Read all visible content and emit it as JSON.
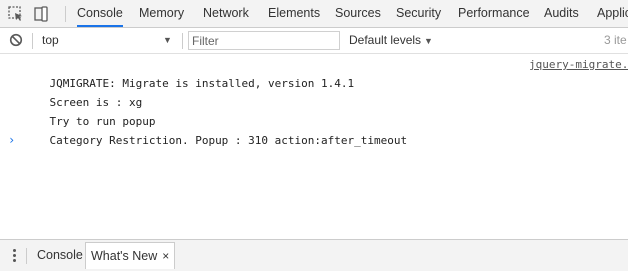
{
  "tabbar": {
    "tabs": [
      {
        "label": "Console",
        "active": true
      },
      {
        "label": "Memory",
        "active": false
      },
      {
        "label": "Network",
        "active": false
      },
      {
        "label": "Elements",
        "active": false
      },
      {
        "label": "Sources",
        "active": false
      },
      {
        "label": "Security",
        "active": false
      },
      {
        "label": "Performance",
        "active": false
      },
      {
        "label": "Audits",
        "active": false
      },
      {
        "label": "Applic",
        "active": false
      }
    ]
  },
  "toolbar": {
    "context": "top",
    "filter_placeholder": "Filter",
    "filter_value": "",
    "levels": "Default levels",
    "issues": "3 ite"
  },
  "messages": [
    {
      "text": "JQMIGRATE: Migrate is installed, version 1.4.1",
      "source": "jquery-migrate."
    },
    {
      "text": "Screen is : xg",
      "source": ""
    },
    {
      "text": "Try to run popup",
      "source": ""
    },
    {
      "text": "Category Restriction. Popup : 310 action:after_timeout",
      "source": ""
    }
  ],
  "prompt": "›",
  "drawer": {
    "tabs": [
      {
        "label": "Console",
        "active": false
      },
      {
        "label": "What's New",
        "active": true,
        "close": "×"
      }
    ]
  },
  "colors": {
    "accent": "#1a73e8",
    "bar_bg": "#f3f3f3",
    "border": "#cccccc"
  }
}
